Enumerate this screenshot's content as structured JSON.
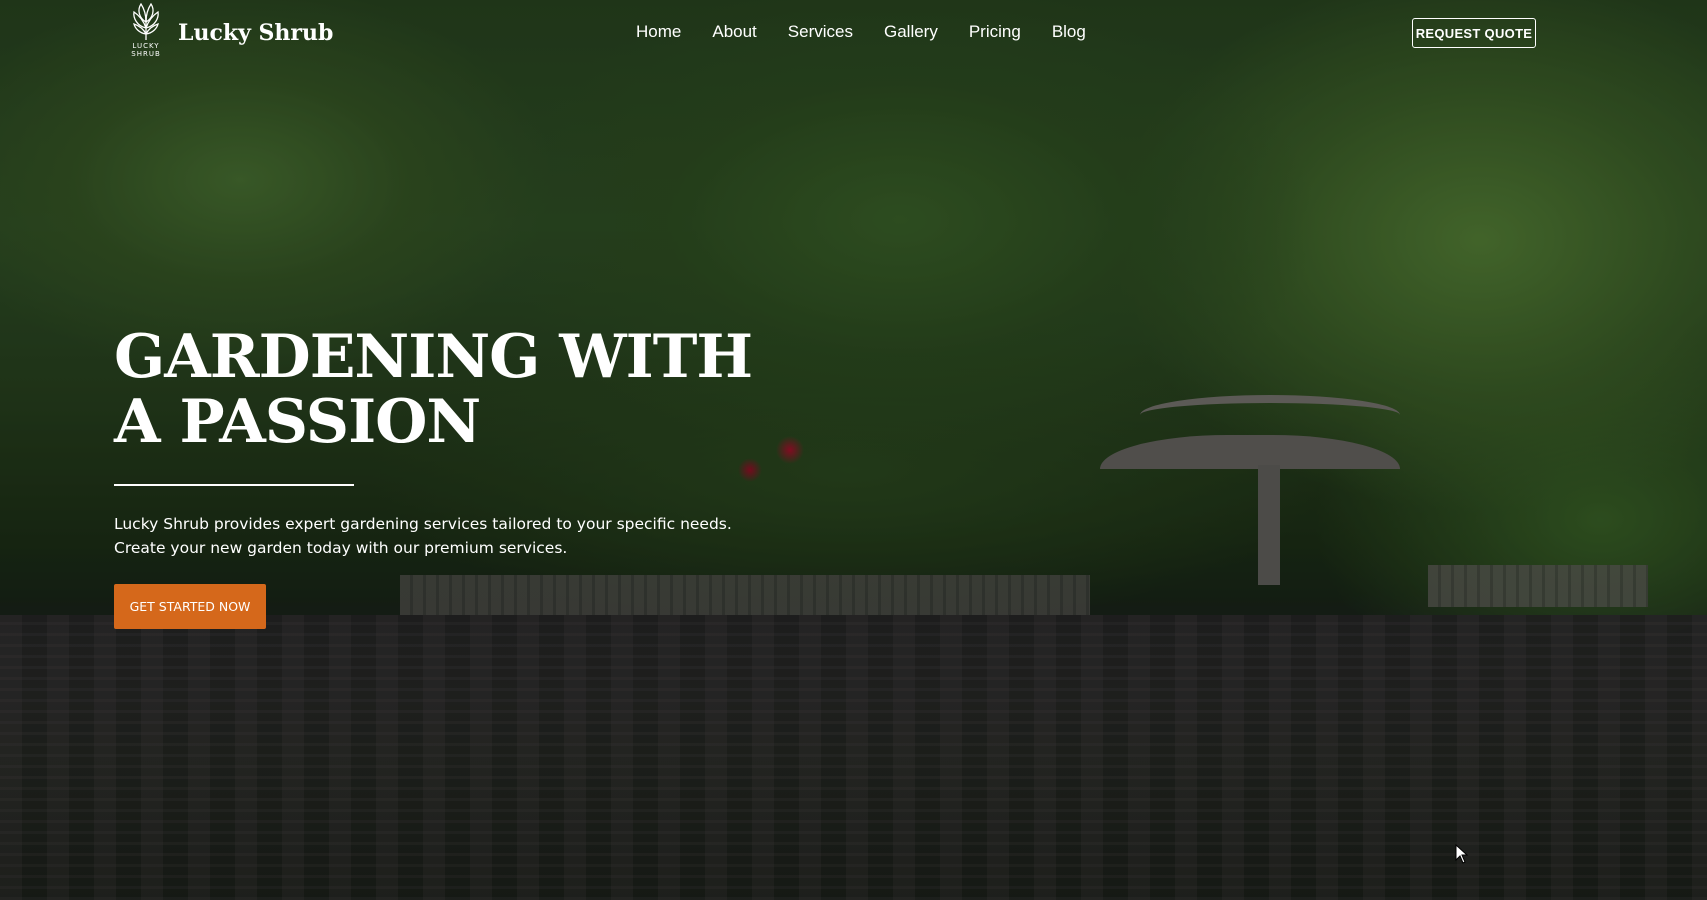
{
  "brand": {
    "name": "Lucky Shrub",
    "mark_text_line1": "LUCKY",
    "mark_text_line2": "SHRUB",
    "icon": "plant-icon"
  },
  "nav": {
    "items": [
      {
        "label": "Home"
      },
      {
        "label": "About"
      },
      {
        "label": "Services"
      },
      {
        "label": "Gallery"
      },
      {
        "label": "Pricing"
      },
      {
        "label": "Blog"
      }
    ],
    "quote_label": "REQUEST QUOTE"
  },
  "hero": {
    "title_line1": "GARDENING WITH",
    "title_line2": "A PASSION",
    "text_line1": "Lucky Shrub provides expert gardening services tailored to your specific needs.",
    "text_line2": "Create your new garden today with our premium services.",
    "cta_label": "GET STARTED NOW"
  },
  "colors": {
    "accent": "#d5681b",
    "text": "#ffffff"
  },
  "background": {
    "image_subject": "japanese-garden-pond-bridge"
  },
  "cursor": {
    "icon": "mouse-pointer-icon"
  }
}
